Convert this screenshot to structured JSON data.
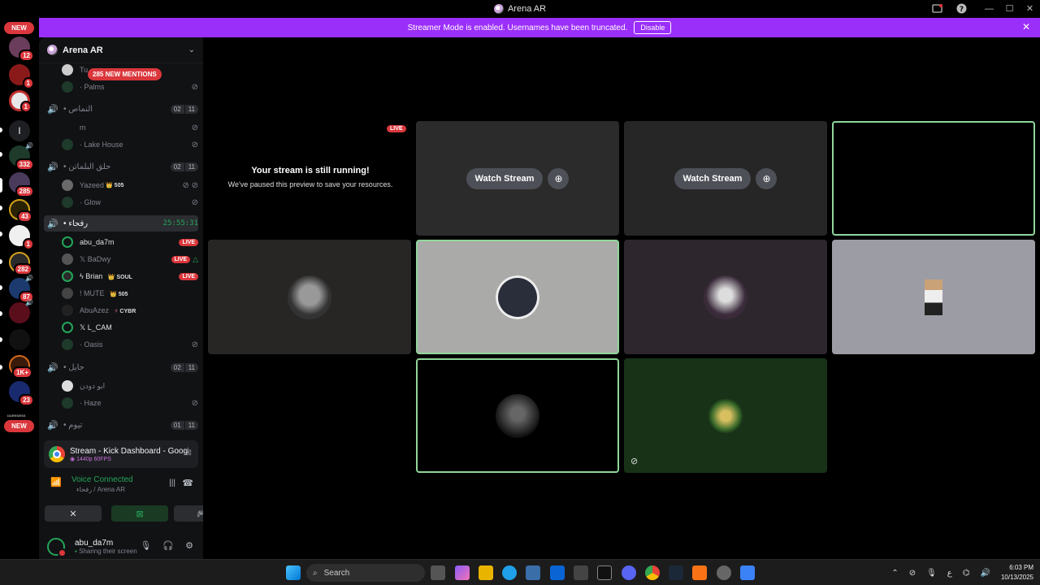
{
  "window": {
    "title": "Arena AR"
  },
  "banner": {
    "text": "Streamer Mode is enabled. Usernames have been truncated.",
    "button": "Disable"
  },
  "rail": {
    "new_top": "NEW",
    "new_bottom": "NEW",
    "badges": [
      "12",
      "1",
      "1",
      "332",
      "285",
      "43",
      "1",
      "282",
      "87",
      "1K+",
      "23"
    ],
    "letter_server": "l",
    "darkness_label": "DARKNESS"
  },
  "server": {
    "name": "Arena AR",
    "mentions": "285 NEW MENTIONS"
  },
  "channels": {
    "c0_user1": "Tu",
    "c0_user2": "Palms",
    "c1": {
      "name": "النماص",
      "count_a": "02",
      "count_b": "11"
    },
    "c1_user1": "m",
    "c1_user2": "Lake House",
    "c2": {
      "name": "حلق البلماتن",
      "count_a": "02",
      "count_b": "11"
    },
    "c2_user1": "Yazeed",
    "c2_user1_tag": "505",
    "c2_user2": "Glow",
    "c3": {
      "name": "رفحاء",
      "timer": "25:55:31"
    },
    "c3_users": [
      {
        "name": "abu_da7m",
        "live": "LIVE"
      },
      {
        "name": "𝕏 BaDwy",
        "live": "LIVE"
      },
      {
        "name": "ϟ Brian",
        "tag": "SOUL",
        "live": "LIVE"
      },
      {
        "name": "! MUTE",
        "tag": "505"
      },
      {
        "name": "AbuAzez",
        "tag": "CYBR"
      },
      {
        "name": "𝕏 L_CAM"
      },
      {
        "name": "Oasis"
      }
    ],
    "c4": {
      "name": "حايل",
      "count_a": "02",
      "count_b": "11"
    },
    "c4_user1": "ابو دودن",
    "c4_user2": "Haze",
    "c5": {
      "name": "تيوم",
      "count_a": "01",
      "count_b": "11"
    }
  },
  "stream_card": {
    "title": "Stream - Kick Dashboard - Google C...",
    "quality": "1440p 60FPS"
  },
  "voice": {
    "status": "Voice Connected",
    "location": "رفحاء / Arena AR"
  },
  "user": {
    "name": "abu_da7m",
    "status": "Sharing their screen"
  },
  "stage": {
    "live_label": "LIVE",
    "paused_title": "Your stream is still running!",
    "paused_sub": "We've paused this preview to save your resources.",
    "watch_1": "Watch Stream",
    "watch_2": "Watch Stream"
  },
  "taskbar": {
    "search": "Search",
    "time": "6:03 PM",
    "date": "10/13/2025",
    "lang": "ع"
  },
  "colors": {
    "banner": "#9b2ffa",
    "accent_green": "#23a55a",
    "live_red": "#da373c"
  }
}
